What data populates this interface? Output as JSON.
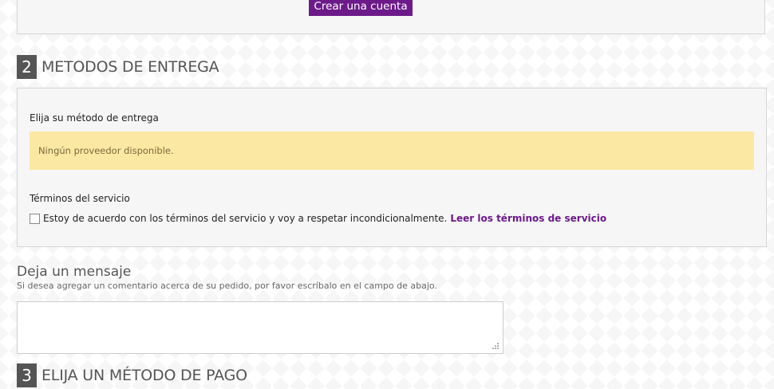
{
  "account": {
    "create_button_label": "Crear una cuenta"
  },
  "step2": {
    "number": "2",
    "title": "METODOS DE ENTREGA",
    "delivery_label": "Elija su método de entrega",
    "no_provider_message": "Ningún proveedor disponible.",
    "terms_label": "Términos del servicio",
    "terms_agree_text": "Estoy de acuerdo con los términos del servicio y voy a respetar incondicionalmente.",
    "terms_link_text": "Leer los términos de servicio"
  },
  "message": {
    "title": "Deja un mensaje",
    "hint": "Si desea agregar un comentario acerca de su pedido, por favor escríbalo en el campo de abajo.",
    "value": ""
  },
  "step3": {
    "number": "3",
    "title": "ELIJA UN MÉTODO DE PAGO"
  },
  "colors": {
    "accent": "#6c1a8a",
    "step_badge": "#555555",
    "panel_bg": "#f6f6f6",
    "warning_bg": "#fbe8a2"
  },
  "icons": {
    "resize": "resize-grip-icon"
  }
}
